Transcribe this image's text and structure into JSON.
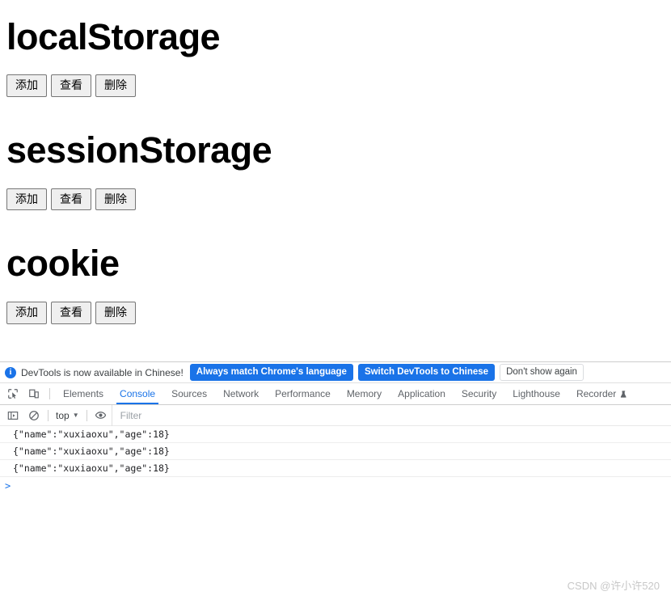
{
  "page": {
    "sections": [
      {
        "title": "localStorage",
        "buttons": [
          {
            "label": "添加",
            "name": "add"
          },
          {
            "label": "查看",
            "name": "view"
          },
          {
            "label": "删除",
            "name": "delete"
          }
        ]
      },
      {
        "title": "sessionStorage",
        "buttons": [
          {
            "label": "添加",
            "name": "add"
          },
          {
            "label": "查看",
            "name": "view"
          },
          {
            "label": "删除",
            "name": "delete"
          }
        ]
      },
      {
        "title": "cookie",
        "buttons": [
          {
            "label": "添加",
            "name": "add"
          },
          {
            "label": "查看",
            "name": "view"
          },
          {
            "label": "删除",
            "name": "delete"
          }
        ]
      }
    ]
  },
  "devtools": {
    "banner": {
      "icon": "info-icon",
      "message": "DevTools is now available in Chinese!",
      "buttons": [
        {
          "label": "Always match Chrome's language",
          "style": "primary"
        },
        {
          "label": "Switch DevTools to Chinese",
          "style": "primary"
        },
        {
          "label": "Don't show again",
          "style": "secondary"
        }
      ]
    },
    "left_icons": [
      {
        "name": "inspect-element-icon"
      },
      {
        "name": "device-toolbar-icon"
      }
    ],
    "tabs": [
      {
        "label": "Elements",
        "active": false
      },
      {
        "label": "Console",
        "active": true
      },
      {
        "label": "Sources",
        "active": false
      },
      {
        "label": "Network",
        "active": false
      },
      {
        "label": "Performance",
        "active": false
      },
      {
        "label": "Memory",
        "active": false
      },
      {
        "label": "Application",
        "active": false
      },
      {
        "label": "Security",
        "active": false
      },
      {
        "label": "Lighthouse",
        "active": false
      },
      {
        "label": "Recorder",
        "active": false,
        "icon": "experiment-flask-icon"
      }
    ],
    "console_toolbar": {
      "sidebar_icon": "console-sidebar-icon",
      "clear_icon": "clear-console-icon",
      "context": "top",
      "context_caret": "▼",
      "eye_icon": "live-expression-eye-icon",
      "filter_placeholder": "Filter"
    },
    "console_messages": [
      "{\"name\":\"xuxiaoxu\",\"age\":18}",
      "{\"name\":\"xuxiaoxu\",\"age\":18}",
      "{\"name\":\"xuxiaoxu\",\"age\":18}"
    ],
    "prompt_symbol": ">"
  },
  "watermark": "CSDN @许小许520",
  "colors": {
    "accent": "#1a73e8",
    "tab_text": "#5f6368",
    "console_text": "#202124",
    "watermark": "#c8c8c8"
  }
}
